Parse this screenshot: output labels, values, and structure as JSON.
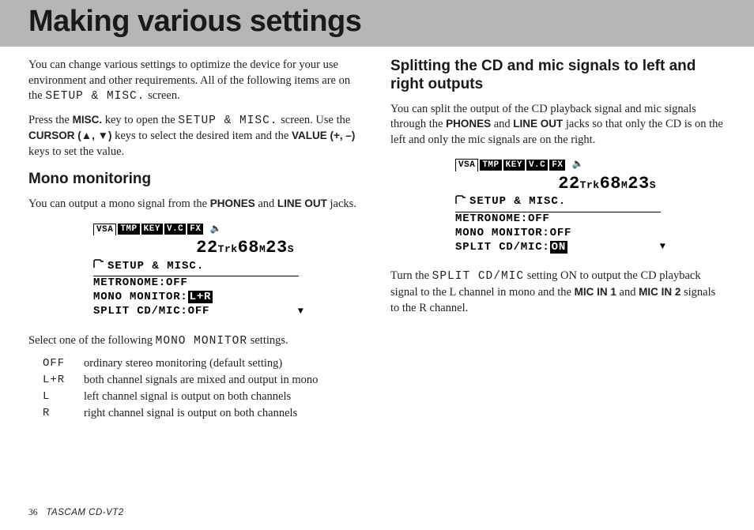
{
  "title": "Making various settings",
  "intro_p1a": "You can change various settings to optimize the device for your use environment and other requirements. All of the following items are on the ",
  "setup_misc": "SETUP & MISC.",
  "intro_p1b": " screen.",
  "intro_p2a": "Press the ",
  "misc_key": "MISC.",
  "intro_p2b": " key to open the ",
  "intro_p2c": " screen. Use the ",
  "cursor_key": "CURSOR (▲, ▼)",
  "intro_p2d": " keys to select the desired item and the ",
  "value_key": "VALUE (+, –)",
  "intro_p2e": " keys to set the value.",
  "h2_mono": "Mono monitoring",
  "mono_p_a": "You can output a mono signal from the ",
  "phones": "PHONES",
  "mono_p_b": " and ",
  "lineout": "LINE OUT",
  "mono_p_c": " jacks.",
  "lcd1": {
    "tabs": [
      "VSA",
      "TMP",
      "KEY",
      "V.C",
      "FX"
    ],
    "tc_a": "22",
    "tc_trk": "Trk",
    "tc_b": "68",
    "tc_m": "M",
    "tc_c": "23",
    "tc_s": "S",
    "folder": "SETUP & MISC.",
    "l1": "METRONOME:OFF",
    "l2a": "MONO MONITOR:",
    "l2hi": "L+R",
    "l3": "SPLIT CD/MIC:OFF"
  },
  "mono_select_a": "Select one of the following ",
  "mono_monitor_mono": "MONO MONITOR",
  "mono_select_b": " settings.",
  "options": [
    {
      "k": "OFF",
      "v": "ordinary stereo monitoring (default setting)"
    },
    {
      "k": "L+R",
      "v": "both channel signals are mixed and output in mono"
    },
    {
      "k": "L",
      "v": "left channel signal is output on both channels"
    },
    {
      "k": "R",
      "v": "right channel signal is output on both channels"
    }
  ],
  "h2_split": "Splitting the CD and mic signals to left and right outputs",
  "split_p1a": "You can split the output of the CD playback signal and mic signals through the ",
  "split_p1b": " and ",
  "split_p1c": " jacks so that only the CD is on the left and only the mic signals are on the right.",
  "lcd2": {
    "tabs": [
      "VSA",
      "TMP",
      "KEY",
      "V.C",
      "FX"
    ],
    "tc_a": "22",
    "tc_trk": "Trk",
    "tc_b": "68",
    "tc_m": "M",
    "tc_c": "23",
    "tc_s": "S",
    "folder": "SETUP & MISC.",
    "l1": "METRONOME:OFF",
    "l2": "MONO MONITOR:OFF",
    "l3a": "SPLIT CD/MIC:",
    "l3hi": "ON"
  },
  "split_p2a": "Turn the ",
  "split_setting": "SPLIT CD/MIC",
  "split_p2b": " setting ON to output the CD playback signal to the L channel in mono and the ",
  "micin1": "MIC IN 1",
  "split_p2c": " and ",
  "micin2": "MIC IN 2",
  "split_p2d": " signals to the R channel.",
  "page_num": "36",
  "model": "TASCAM  CD-VT2"
}
